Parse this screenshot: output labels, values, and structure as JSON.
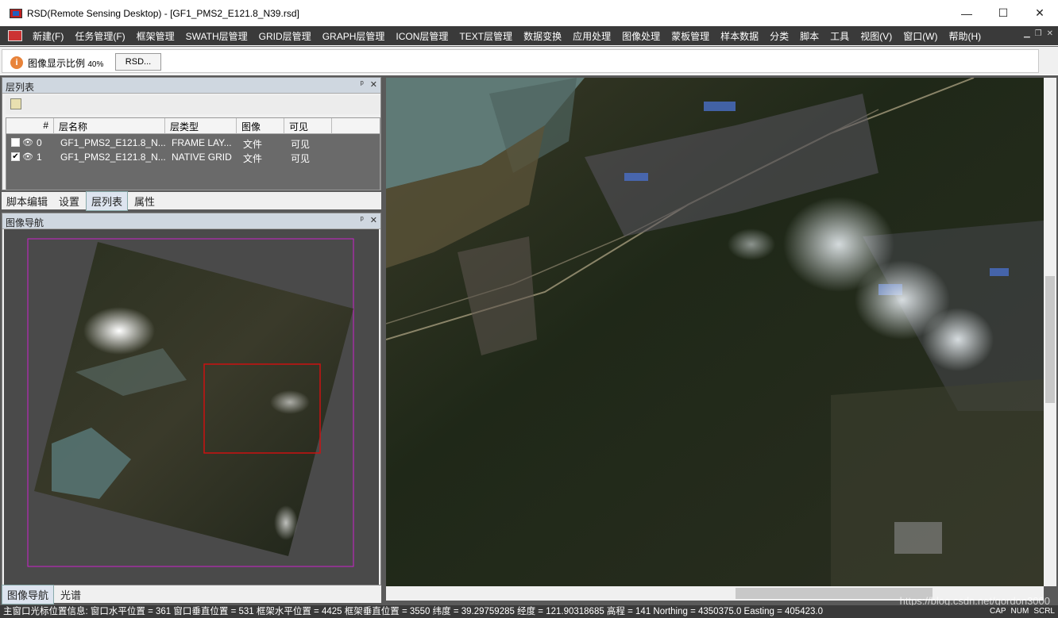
{
  "window": {
    "title": "RSD(Remote Sensing Desktop) - [GF1_PMS2_E121.8_N39.rsd]",
    "minimize": "—",
    "maximize": "☐",
    "close": "✕"
  },
  "menu": {
    "items": [
      "新建(F)",
      "任务管理(F)",
      "框架管理",
      "SWATH层管理",
      "GRID层管理",
      "GRAPH层管理",
      "ICON层管理",
      "TEXT层管理",
      "数据变换",
      "应用处理",
      "图像处理",
      "蒙板管理",
      "样本数据",
      "分类",
      "脚本",
      "工具",
      "视图(V)",
      "窗口(W)",
      "帮助(H)"
    ]
  },
  "infobar": {
    "label": "图像显示比例",
    "scale": "40%",
    "button": "RSD..."
  },
  "layer_panel": {
    "title": "层列表",
    "pin": "ᵖ",
    "close": "✕",
    "columns": [
      "#",
      "层名称",
      "层类型",
      "图像",
      "可见"
    ],
    "rows": [
      {
        "checked": "",
        "index": "0",
        "name": "GF1_PMS2_E121.8_N...",
        "type": "FRAME LAY...",
        "image": "文件",
        "visible": "可见"
      },
      {
        "checked": "✔",
        "index": "1",
        "name": "GF1_PMS2_E121.8_N...",
        "type": "NATIVE GRID",
        "image": "文件",
        "visible": "可见"
      }
    ]
  },
  "tabs_top": [
    "脚本编辑",
    "设置",
    "层列表",
    "属性"
  ],
  "nav_panel": {
    "title": "图像导航",
    "pin": "ᵖ",
    "close": "✕"
  },
  "tabs_bottom": [
    "图像导航",
    "光谱"
  ],
  "statusbar": {
    "text": "主窗口光标位置信息:  窗口水平位置 = 361 窗口垂直位置 = 531 框架水平位置 = 4425 框架垂直位置 = 3550 纬度 = 39.29759285 经度 = 121.90318685 高程  = 141 Northing = 4350375.0 Easting = 405423.0",
    "caps": "CAP",
    "num": "NUM",
    "scrl": "SCRL"
  },
  "watermark": "https://blog.csdn.net/gordon3000",
  "colors": {
    "menubar": "#3a3a3a",
    "nav_frame": "#cc22cc",
    "nav_viewport": "#cc1111"
  }
}
